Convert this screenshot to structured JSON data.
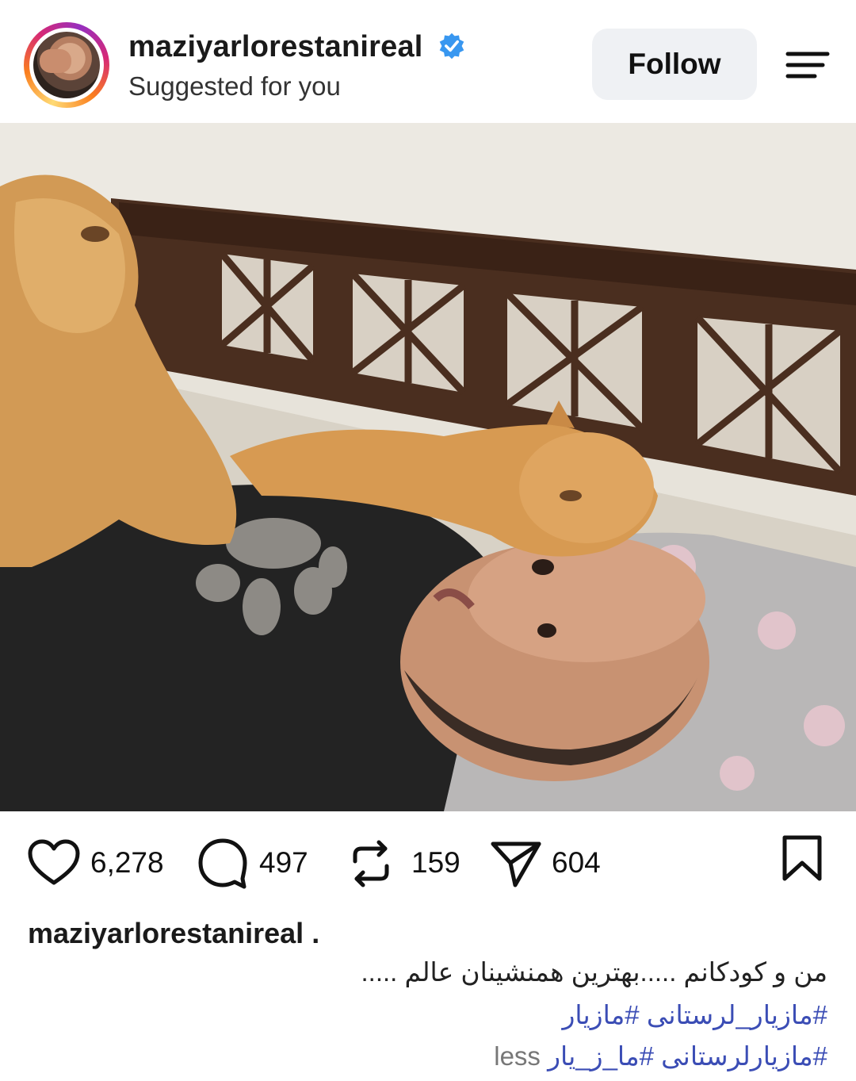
{
  "header": {
    "username": "maziyarlorestanireal",
    "subtitle": "Suggested for you",
    "follow_label": "Follow",
    "verified_color": "#3897f0"
  },
  "post": {
    "likes": "6,278",
    "comments": "497",
    "reposts": "159",
    "shares": "604"
  },
  "caption": {
    "username": "maziyarlorestanireal .",
    "line1": "من و کودکانم .....بهترین همنشینان عالم .....",
    "line2_tags": "#مازیار_لرستانی #مازیار",
    "line3_tags": "#مازیارلرستانی #ما_ز_یار",
    "less_label": "less"
  },
  "icons": {
    "like": "heart-icon",
    "comment": "comment-bubble-icon",
    "repost": "repost-arrows-icon",
    "share": "paper-plane-icon",
    "save": "bookmark-icon",
    "menu": "menu-icon",
    "verified": "verified-badge-icon"
  },
  "colors": {
    "tag_link": "#3b4db5",
    "follow_bg": "#eff1f4"
  }
}
